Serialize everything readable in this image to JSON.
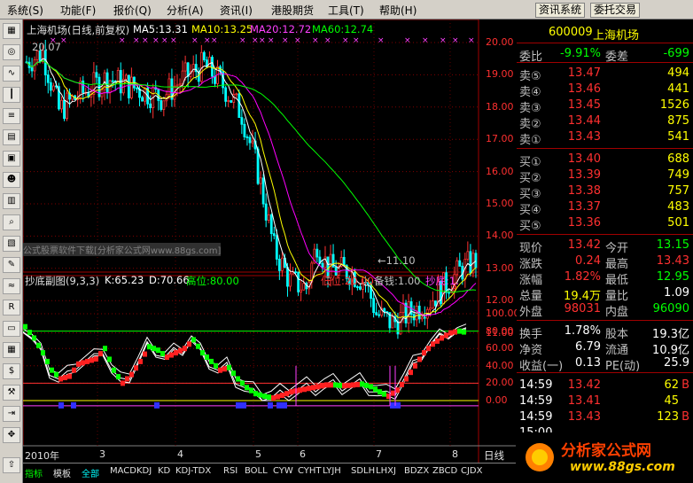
{
  "menu": [
    "系统(S)",
    "功能(F)",
    "报价(Q)",
    "分析(A)",
    "资讯(I)",
    "港股期货",
    "工具(T)",
    "帮助(H)"
  ],
  "menu_right": [
    "资讯系统",
    "委托交易"
  ],
  "toolbar_icons": [
    "chart-icon",
    "compass-icon",
    "line-chart-icon",
    "candle-icon",
    "list-icon",
    "table-icon",
    "document-icon",
    "people-icon",
    "calculator-icon",
    "magnifier-icon",
    "stock-icon",
    "edit-icon",
    "wave-icon",
    "rsi-icon",
    "monitor-icon",
    "grid-icon",
    "dollar-icon",
    "wrench-icon",
    "export-icon",
    "arrow-icon",
    "up-arrow-icon"
  ],
  "main_chart": {
    "title": "上海机场(日线,前复权)",
    "ma5": "MA5:13.31",
    "ma10": "MA10:13.25",
    "ma20": "MA20:12.72",
    "ma60": "MA60:12.74",
    "high_label": "20.07",
    "low_label": "←11.10",
    "watermark": "公式股票软件下载[分析家公式网www.88gs.com]",
    "y_ticks": [
      "20.00",
      "19.00",
      "18.00",
      "17.00",
      "16.00",
      "15.00",
      "14.00",
      "13.00",
      "12.00",
      "11.00"
    ],
    "colors": {
      "ma5": "#ffffff",
      "ma10": "#ffff00",
      "ma20": "#ff00ff",
      "ma60": "#00ff00",
      "up": "#ff3232",
      "down": "#00ffff"
    }
  },
  "sub_chart": {
    "title": "抄底副图(9,3,3)",
    "k": "K:65.23",
    "d": "D:70.66",
    "high": "高位:80.00",
    "low": "低位:20.00",
    "money": "备钱:1.00",
    "bottom": "抄底:1.",
    "y_ticks": [
      "100.00",
      "80.00",
      "60.00",
      "40.00",
      "20.00",
      "0.00"
    ]
  },
  "x_axis": [
    "2010年",
    "3",
    "4",
    "5",
    "6",
    "7",
    "8"
  ],
  "bottom_tabs": [
    "指标",
    "模板",
    "全部",
    "MACD",
    "KDJ",
    "KD",
    "KDJ-TDX",
    "RSI",
    "BOLL",
    "CYW",
    "CYHT",
    "LYJH",
    "SDLH",
    "LHXJ",
    "BDZX",
    "ZBCD",
    "CJDX"
  ],
  "period": "日线",
  "quote": {
    "code": "600009",
    "name": "上海机场",
    "wei_bi_label": "委比",
    "wei_bi": "-9.91%",
    "wei_cha_label": "委差",
    "wei_cha": "-699",
    "asks": [
      {
        "label": "卖⑤",
        "price": "13.47",
        "vol": "494"
      },
      {
        "label": "卖④",
        "price": "13.46",
        "vol": "441"
      },
      {
        "label": "卖③",
        "price": "13.45",
        "vol": "1526"
      },
      {
        "label": "卖②",
        "price": "13.44",
        "vol": "875"
      },
      {
        "label": "卖①",
        "price": "13.43",
        "vol": "541"
      }
    ],
    "bids": [
      {
        "label": "买①",
        "price": "13.40",
        "vol": "688"
      },
      {
        "label": "买②",
        "price": "13.39",
        "vol": "749"
      },
      {
        "label": "买③",
        "price": "13.38",
        "vol": "757"
      },
      {
        "label": "买④",
        "price": "13.37",
        "vol": "483"
      },
      {
        "label": "买⑤",
        "price": "13.36",
        "vol": "501"
      }
    ],
    "stats": [
      {
        "l1": "现价",
        "v1": "13.42",
        "l2": "今开",
        "v2": "13.15"
      },
      {
        "l1": "涨跌",
        "v1": "0.24",
        "l2": "最高",
        "v2": "13.43"
      },
      {
        "l1": "涨幅",
        "v1": "1.82%",
        "l2": "最低",
        "v2": "12.95"
      },
      {
        "l1": "总量",
        "v1": "19.4万",
        "l2": "量比",
        "v2": "1.09"
      },
      {
        "l1": "外盘",
        "v1": "98031",
        "l2": "内盘",
        "v2": "96090"
      }
    ],
    "stats2": [
      {
        "l1": "换手",
        "v1": "1.78%",
        "l2": "股本",
        "v2": "19.3亿"
      },
      {
        "l1": "净资",
        "v1": "6.79",
        "l2": "流通",
        "v2": "10.9亿"
      },
      {
        "l1": "收益(一)",
        "v1": "0.13",
        "l2": "PE(动)",
        "v2": "25.9"
      }
    ],
    "ticks": [
      {
        "time": "14:59",
        "price": "13.42",
        "vol": "62",
        "dir": "B"
      },
      {
        "time": "14:59",
        "price": "13.41",
        "vol": "45",
        "dir": ""
      },
      {
        "time": "14:59",
        "price": "13.43",
        "vol": "123",
        "dir": "B"
      },
      {
        "time": "15:00",
        "price": "",
        "vol": "",
        "dir": ""
      }
    ]
  },
  "logo": {
    "text": "分析家公式网",
    "url": "www.88gs.com"
  }
}
